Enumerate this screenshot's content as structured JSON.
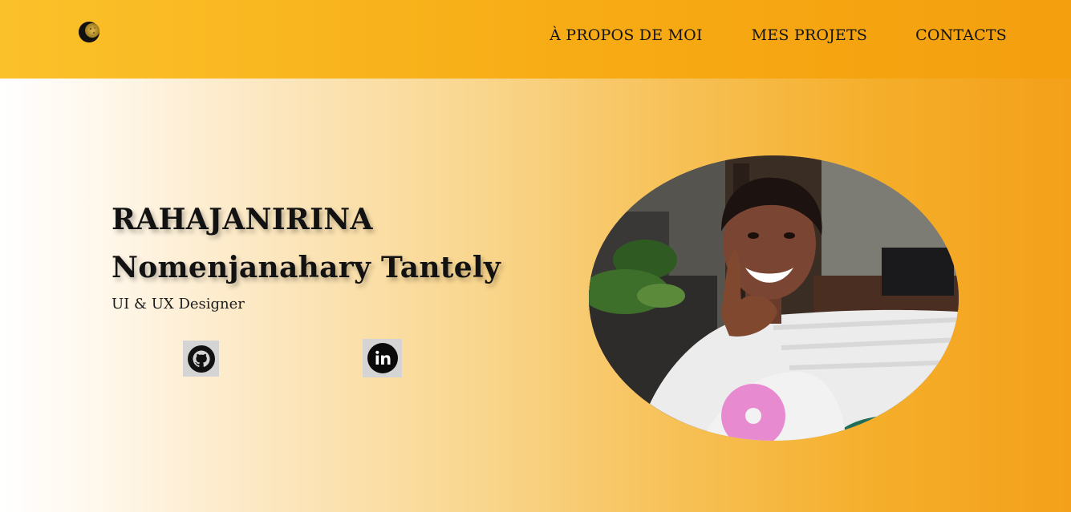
{
  "header": {
    "logo_icon": "crescent-moon-logo-icon",
    "nav": {
      "about": "À PROPOS DE MOI",
      "projects": "MES PROJETS",
      "contacts": "CONTACTS"
    }
  },
  "hero": {
    "name_first": "RAHAJANIRINA",
    "name_second": "Nomenjanahary Tantely",
    "role": "UI & UX Designer",
    "social": {
      "github_icon": "github-icon",
      "linkedin_icon": "linkedin-icon"
    },
    "photo": "profile-photo"
  },
  "colors": {
    "header_gradient_start": "#fbc12a",
    "header_gradient_end": "#f49f0e",
    "hero_gradient_start": "#ffffff",
    "hero_gradient_end": "#f4a01a",
    "text": "#121212",
    "social_bg": "#d4d4d4"
  }
}
